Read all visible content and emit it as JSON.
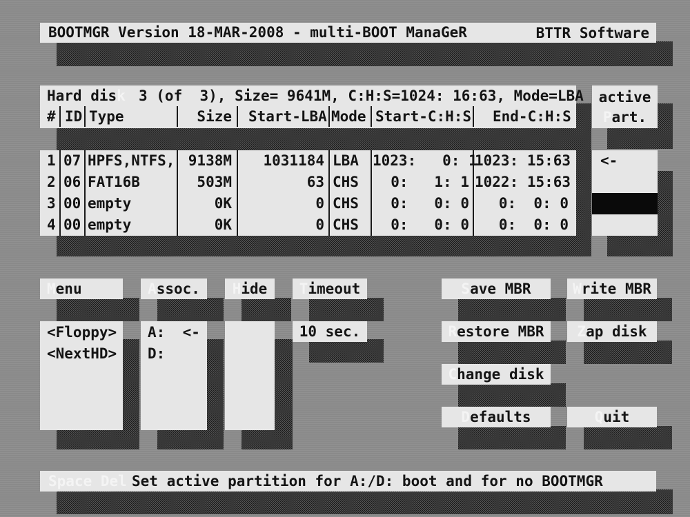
{
  "title_bar": {
    "title": "BOOTMGR Version 18-MAR-2008 - multi-BOOT ManaGeR",
    "vendor": "BTTR Software"
  },
  "disk_panel": {
    "info": "3 (of  3), Size= 9641M, C:H:S=1024: 16:63, Mode=LBA",
    "label_hot": "k",
    "label_text": "Hard dis",
    "columns": [
      "#",
      "ID",
      "Type",
      "Size",
      "Start-LBA",
      "Mode",
      "Start-C:H:S",
      "End-C:H:S"
    ],
    "rows": [
      {
        "num": "1",
        "id": "07",
        "type": "HPFS,NTFS,",
        "size": "9138M",
        "start_lba": "1031184",
        "mode": "LBA",
        "start_chs": "1023:   0: 1",
        "end_chs": "1023: 15:63"
      },
      {
        "num": "2",
        "id": "06",
        "type": "FAT16B",
        "size": "503M",
        "start_lba": "63",
        "mode": "CHS",
        "start_chs": "0:   1: 1",
        "end_chs": "1022: 15:63"
      },
      {
        "num": "3",
        "id": "00",
        "type": "empty",
        "size": "0K",
        "start_lba": "0",
        "mode": "CHS",
        "start_chs": "0:   0: 0",
        "end_chs": "0:  0: 0"
      },
      {
        "num": "4",
        "id": "00",
        "type": "empty",
        "size": "0K",
        "start_lba": "0",
        "mode": "CHS",
        "start_chs": "0:   0: 0",
        "end_chs": "0:  0: 0"
      }
    ]
  },
  "active_panel": {
    "line1": "active",
    "line2_hot": "P",
    "line2_rest": "art.",
    "row1_marker": "<-"
  },
  "menu": {
    "header_hot": "M",
    "header_rest": "enu",
    "items": [
      "<Floppy>",
      "<NextHD>"
    ]
  },
  "assoc": {
    "header_hot": "A",
    "header_rest": "ssoc.",
    "items": [
      "A:  <-",
      "D:"
    ]
  },
  "hide": {
    "header_hot": "H",
    "header_rest": "ide"
  },
  "timeout": {
    "header_hot": "T",
    "header_rest": "imeout",
    "value": "10 sec."
  },
  "buttons": {
    "save_mbr": {
      "hot": "S",
      "rest": "ave MBR"
    },
    "write_mbr": {
      "hot": "W",
      "rest": "rite MBR"
    },
    "restore_mbr": {
      "hot": "R",
      "rest": "estore MBR"
    },
    "zap_disk": {
      "hot": "Z",
      "rest": "ap disk"
    },
    "change_disk": {
      "hot": "C",
      "rest": "hange disk"
    },
    "defaults": {
      "hot": "D",
      "rest": "efaults"
    },
    "quit": {
      "hot": "Q",
      "rest": "uit"
    }
  },
  "status_bar": {
    "keys": "Space Del",
    "message": "Set active partition for A:/D: boot and for no BOOTMGR"
  }
}
